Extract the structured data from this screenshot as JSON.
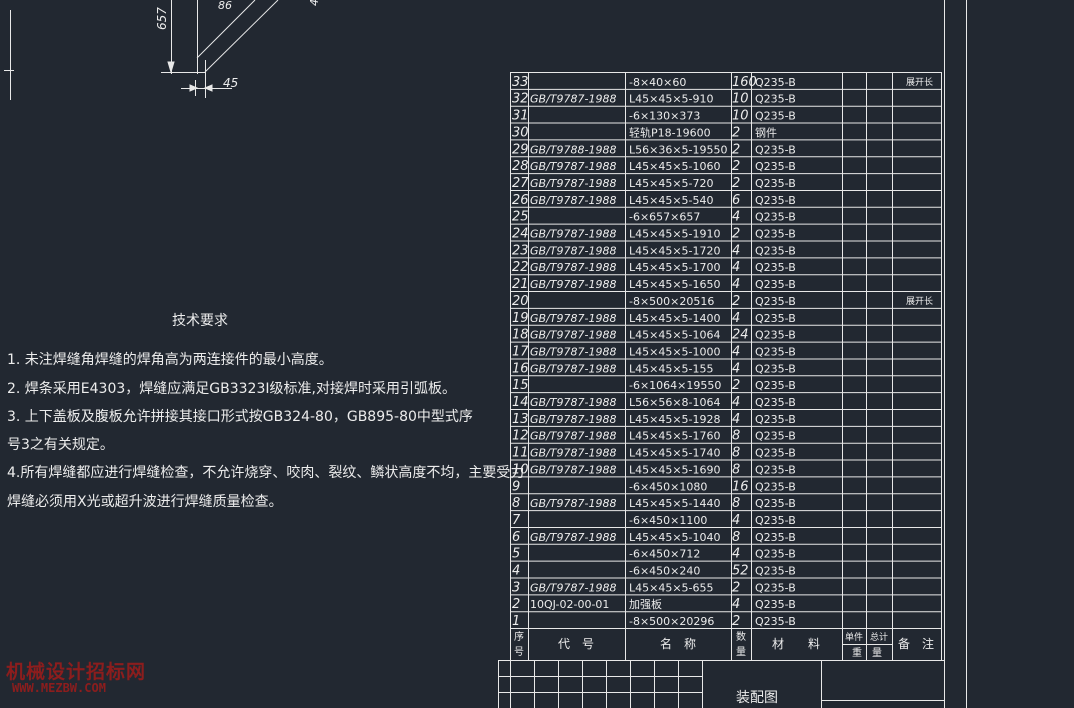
{
  "drawing": {
    "dimensions": {
      "dim_657": "657",
      "dim_86": "86",
      "dim_45": "45",
      "dim_partial_right": "4"
    }
  },
  "tech_requirements": {
    "title": "技术要求",
    "lines": [
      "1. 未注焊缝角焊缝的焊角高为两连接件的最小高度。",
      "2. 焊条采用E4303，焊缝应满足GB3323Ⅰ级标准,对接焊时采用引弧板。",
      "3. 上下盖板及腹板允许拼接其接口形式按GB324-80，GB895-80中型式序",
      "号3之有关规定。",
      "4.所有焊缝都应进行焊缝检查，不允许烧穿、咬肉、裂纹、鳞状高度不均，主要受力",
      "焊缝必须用X光或超升波进行焊缝质量检查。"
    ]
  },
  "watermark": {
    "line1": "机械设计招标网",
    "line2": "WWW.MEZBW.COM"
  },
  "bom": {
    "rows": [
      {
        "no": "33",
        "std": "",
        "name": "-8×40×60",
        "qty": "160",
        "mat": "Q235-B",
        "note": "展开长"
      },
      {
        "no": "32",
        "std": "GB/T9787-1988",
        "name": "L45×45×5-910",
        "qty": "10",
        "mat": "Q235-B",
        "note": ""
      },
      {
        "no": "31",
        "std": "",
        "name": "-6×130×373",
        "qty": "10",
        "mat": "Q235-B",
        "note": ""
      },
      {
        "no": "30",
        "std": "",
        "name": "轻轨P18-19600",
        "qty": "2",
        "mat": "钢件",
        "note": ""
      },
      {
        "no": "29",
        "std": "GB/T9788-1988",
        "name": "L56×36×5-19550",
        "qty": "2",
        "mat": "Q235-B",
        "note": ""
      },
      {
        "no": "28",
        "std": "GB/T9787-1988",
        "name": "L45×45×5-1060",
        "qty": "2",
        "mat": "Q235-B",
        "note": ""
      },
      {
        "no": "27",
        "std": "GB/T9787-1988",
        "name": "L45×45×5-720",
        "qty": "2",
        "mat": "Q235-B",
        "note": ""
      },
      {
        "no": "26",
        "std": "GB/T9787-1988",
        "name": "L45×45×5-540",
        "qty": "6",
        "mat": "Q235-B",
        "note": ""
      },
      {
        "no": "25",
        "std": "",
        "name": "-6×657×657",
        "qty": "4",
        "mat": "Q235-B",
        "note": ""
      },
      {
        "no": "24",
        "std": "GB/T9787-1988",
        "name": "L45×45×5-1910",
        "qty": "2",
        "mat": "Q235-B",
        "note": ""
      },
      {
        "no": "23",
        "std": "GB/T9787-1988",
        "name": "L45×45×5-1720",
        "qty": "4",
        "mat": "Q235-B",
        "note": ""
      },
      {
        "no": "22",
        "std": "GB/T9787-1988",
        "name": "L45×45×5-1700",
        "qty": "4",
        "mat": "Q235-B",
        "note": ""
      },
      {
        "no": "21",
        "std": "GB/T9787-1988",
        "name": "L45×45×5-1650",
        "qty": "4",
        "mat": "Q235-B",
        "note": ""
      },
      {
        "no": "20",
        "std": "",
        "name": "-8×500×20516",
        "qty": "2",
        "mat": "Q235-B",
        "note": "展开长"
      },
      {
        "no": "19",
        "std": "GB/T9787-1988",
        "name": "L45×45×5-1400",
        "qty": "4",
        "mat": "Q235-B",
        "note": ""
      },
      {
        "no": "18",
        "std": "GB/T9787-1988",
        "name": "L45×45×5-1064",
        "qty": "24",
        "mat": "Q235-B",
        "note": ""
      },
      {
        "no": "17",
        "std": "GB/T9787-1988",
        "name": "L45×45×5-1000",
        "qty": "4",
        "mat": "Q235-B",
        "note": ""
      },
      {
        "no": "16",
        "std": "GB/T9787-1988",
        "name": "L45×45×5-155",
        "qty": "4",
        "mat": "Q235-B",
        "note": ""
      },
      {
        "no": "15",
        "std": "",
        "name": "-6×1064×19550",
        "qty": "2",
        "mat": "Q235-B",
        "note": ""
      },
      {
        "no": "14",
        "std": "GB/T9787-1988",
        "name": "L56×56×8-1064",
        "qty": "4",
        "mat": "Q235-B",
        "note": ""
      },
      {
        "no": "13",
        "std": "GB/T9787-1988",
        "name": "L45×45×5-1928",
        "qty": "4",
        "mat": "Q235-B",
        "note": ""
      },
      {
        "no": "12",
        "std": "GB/T9787-1988",
        "name": "L45×45×5-1760",
        "qty": "8",
        "mat": "Q235-B",
        "note": ""
      },
      {
        "no": "11",
        "std": "GB/T9787-1988",
        "name": "L45×45×5-1740",
        "qty": "8",
        "mat": "Q235-B",
        "note": ""
      },
      {
        "no": "10",
        "std": "GB/T9787-1988",
        "name": "L45×45×5-1690",
        "qty": "8",
        "mat": "Q235-B",
        "note": ""
      },
      {
        "no": "9",
        "std": "",
        "name": "-6×450×1080",
        "qty": "16",
        "mat": "Q235-B",
        "note": ""
      },
      {
        "no": "8",
        "std": "GB/T9787-1988",
        "name": "L45×45×5-1440",
        "qty": "8",
        "mat": "Q235-B",
        "note": ""
      },
      {
        "no": "7",
        "std": "",
        "name": "-6×450×1100",
        "qty": "4",
        "mat": "Q235-B",
        "note": ""
      },
      {
        "no": "6",
        "std": "GB/T9787-1988",
        "name": "L45×45×5-1040",
        "qty": "8",
        "mat": "Q235-B",
        "note": ""
      },
      {
        "no": "5",
        "std": "",
        "name": "-6×450×712",
        "qty": "4",
        "mat": "Q235-B",
        "note": ""
      },
      {
        "no": "4",
        "std": "",
        "name": "-6×450×240",
        "qty": "52",
        "mat": "Q235-B",
        "note": ""
      },
      {
        "no": "3",
        "std": "GB/T9787-1988",
        "name": "L45×45×5-655",
        "qty": "2",
        "mat": "Q235-B",
        "note": ""
      },
      {
        "no": "2",
        "std": "10QJ-02-00-01",
        "name": "加强板",
        "qty": "4",
        "mat": "Q235-B",
        "note": ""
      },
      {
        "no": "1",
        "std": "",
        "name": "-8×500×20296",
        "qty": "2",
        "mat": "Q235-B",
        "note": ""
      }
    ],
    "header": {
      "no_top": "序",
      "no_bottom": "号",
      "std": "代　号",
      "name": "名　称",
      "qty_top": "数",
      "qty_bottom": "量",
      "mat": "材　　料",
      "unit_weight": "单件",
      "total_weight": "总计",
      "weight": "重　量",
      "note": "备　注"
    },
    "title_block": {
      "drawing_name": "装配图"
    }
  }
}
